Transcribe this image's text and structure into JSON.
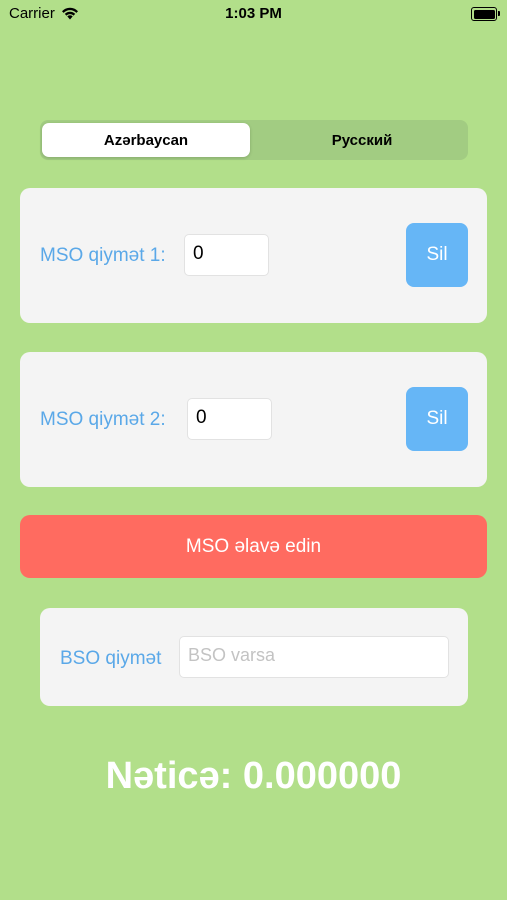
{
  "status_bar": {
    "carrier": "Carrier",
    "time": "1:03 PM",
    "wifi_icon": "wifi-icon",
    "battery_icon": "battery-icon"
  },
  "language_tabs": [
    {
      "label": "Azərbaycan",
      "selected": true
    },
    {
      "label": "Русский",
      "selected": false
    }
  ],
  "mso_rows": [
    {
      "label": "MSO qiymət 1:",
      "value": "0",
      "delete_label": "Sil"
    },
    {
      "label": "MSO qiymət 2:",
      "value": "0",
      "delete_label": "Sil"
    }
  ],
  "add_button": {
    "label": "MSO əlavə edin"
  },
  "bso": {
    "label": "BSO qiymət",
    "placeholder": "BSO varsa",
    "value": ""
  },
  "result": {
    "text": "Nəticə: 0.000000"
  },
  "colors": {
    "background": "#b2df8a",
    "card": "#f4f4f4",
    "label_blue": "#5aa8e8",
    "delete_blue": "#66b6f6",
    "add_red": "#ff6b60"
  }
}
